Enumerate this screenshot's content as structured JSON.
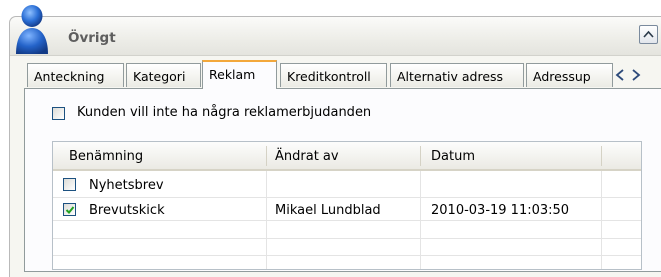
{
  "panel": {
    "title": "Övrigt",
    "icon": "user-icon",
    "collapse_icon": "chevron-up-icon"
  },
  "tabs": [
    {
      "label": "Anteckning"
    },
    {
      "label": "Kategori"
    },
    {
      "label": "Reklam",
      "active": true
    },
    {
      "label": "Kreditkontroll"
    },
    {
      "label": "Alternativ adress"
    },
    {
      "label": "Adressup"
    }
  ],
  "tab_scroll": {
    "left_icon": "chevron-left-icon",
    "right_icon": "chevron-right-icon"
  },
  "reklam": {
    "optout_label": "Kunden vill inte ha några reklamerbjudanden",
    "optout_checked": false,
    "grid": {
      "columns": [
        "Benämning",
        "Ändrat av",
        "Datum"
      ],
      "rows": [
        {
          "checked": false,
          "name": "Nyhetsbrev",
          "changed_by": "",
          "date": ""
        },
        {
          "checked": true,
          "name": "Brevutskick",
          "changed_by": "Mikael Lundblad",
          "date": "2010-03-19 11:03:50"
        }
      ]
    }
  },
  "colors": {
    "accent_tab": "#f3a83b",
    "check_green": "#21a121",
    "icon_blue": "#1f5fbf"
  }
}
